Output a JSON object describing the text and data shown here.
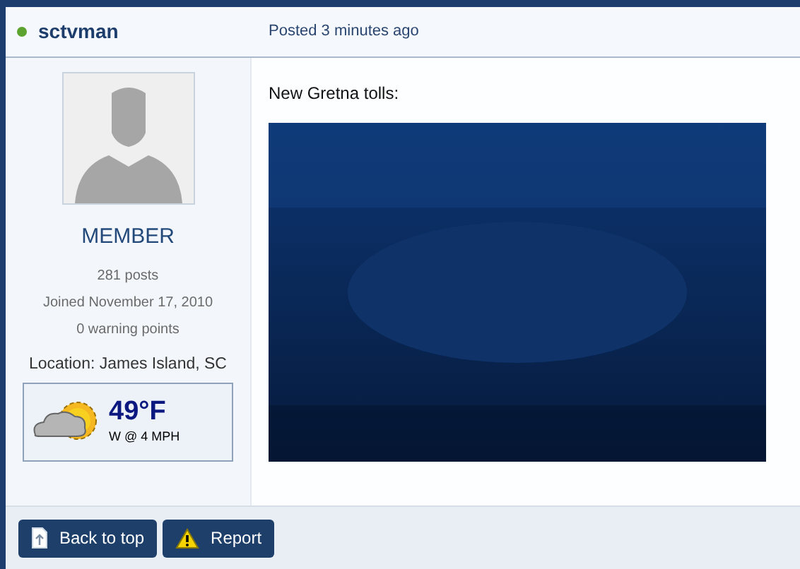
{
  "author": {
    "name": "sctvman",
    "online": true
  },
  "posted": "Posted 3 minutes ago",
  "profile": {
    "rank": "MEMBER",
    "stats": [
      "281 posts",
      "Joined November 17, 2010",
      "0 warning points"
    ],
    "location": "Location: James Island, SC"
  },
  "weather": {
    "temperature": "49°F",
    "wind": "W @ 4 MPH"
  },
  "post": {
    "text": "New Gretna tolls:"
  },
  "buttons": [
    {
      "kind": "top",
      "label": "Back to top"
    },
    {
      "kind": "report",
      "label": "Report"
    }
  ]
}
